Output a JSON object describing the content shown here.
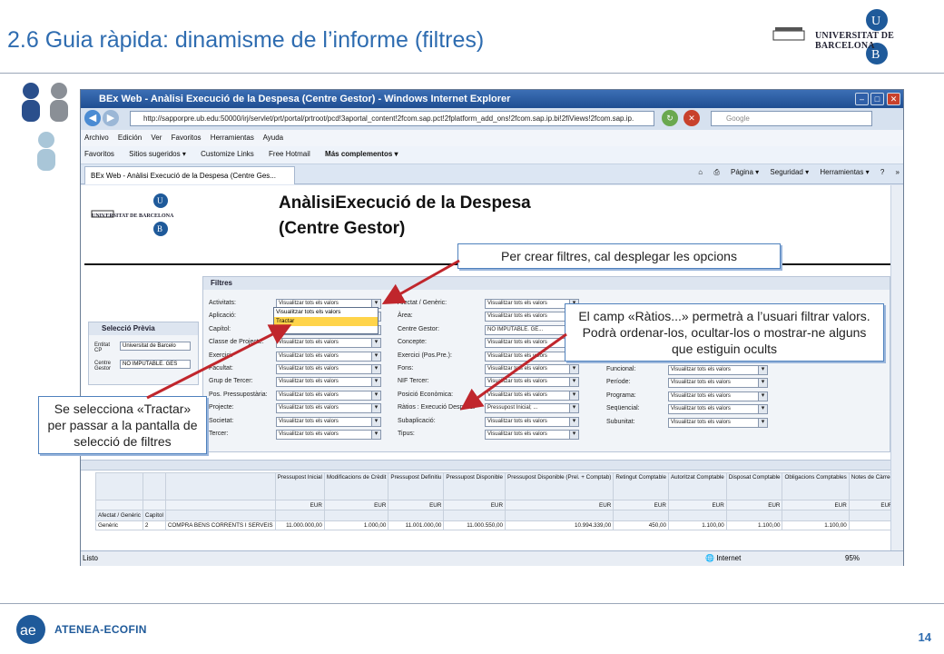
{
  "slide": {
    "title": "2.6 Guia ràpida: dinamisme de l’informe (filtres)",
    "university_name": "UNIVERSITAT DE BARCELONA",
    "page_number": "14",
    "footer_brand": "ATENEA-ECOFIN"
  },
  "browser": {
    "window_title": "BEx Web - Anàlisi Execució de la Despesa (Centre Gestor) - Windows Internet Explorer",
    "address": "http://sapporpre.ub.edu:50000/irj/servlet/prt/portal/prtroot/pcd!3aportal_content!2fcom.sap.pct!2fplatform_add_ons!2fcom.sap.ip.bi!2fiViews!2fcom.sap.ip.",
    "search_placeholder": "Google",
    "menu": [
      "Archivo",
      "Edición",
      "Ver",
      "Favoritos",
      "Herramientas",
      "Ayuda"
    ],
    "favorites": [
      "Favoritos",
      "Sitios sugeridos ▾",
      "Customize Links",
      "Free Hotmail",
      "Más complementos ▾"
    ],
    "tab_title": "BEx Web - Anàlisi Execució de la Despesa (Centre Ges...",
    "commands": [
      "Página ▾",
      "Seguridad ▾",
      "Herramientas ▾",
      "»"
    ],
    "status_left": "Listo",
    "status_zone": "Internet",
    "zoom": "95%"
  },
  "report": {
    "title_line1": "AnàlisiExecució de la Despesa",
    "title_line2": "(Centre Gestor)",
    "filters_heading": "Filtres",
    "prev_heading": "Selecció Prèvia",
    "prev_rows": [
      {
        "label": "Entitat CP",
        "value": "Universitat de Barcelo"
      },
      {
        "label": "Centre Gestor",
        "value": "NO IMPUTABLE. GES"
      }
    ],
    "filters_col1": [
      {
        "label": "Activitats:",
        "value": "Visualitzar tots els valors"
      },
      {
        "label": "Aplicació:",
        "value": "Visualitzar tots els valors"
      },
      {
        "label": "Capítol:",
        "value": "Visualitzar tots els valors"
      },
      {
        "label": "Classe de Projecte:",
        "value": "Visualitzar tots els valors"
      },
      {
        "label": "Exercici:",
        "value": "Visualitzar tots els valors"
      },
      {
        "label": "Facultat:",
        "value": "Visualitzar tots els valors"
      },
      {
        "label": "Grup de Tercer:",
        "value": "Visualitzar tots els valors"
      },
      {
        "label": "Pos. Pressupostària:",
        "value": "Visualitzar tots els valors"
      },
      {
        "label": "Projecte:",
        "value": "Visualitzar tots els valors"
      },
      {
        "label": "Societat:",
        "value": "Visualitzar tots els valors"
      },
      {
        "label": "Tercer:",
        "value": "Visualitzar tots els valors"
      }
    ],
    "filters_col2": [
      {
        "label": "Afectat / Genèric:",
        "value": "Visualitzar tots els valors"
      },
      {
        "label": "Àrea:",
        "value": "Visualitzar tots els valors"
      },
      {
        "label": "Centre Gestor:",
        "value": "NO IMPUTABLE. GE..."
      },
      {
        "label": "Concepte:",
        "value": "Visualitzar tots els valors"
      },
      {
        "label": "Exercici (Pos.Pre.):",
        "value": "Visualitzar tots els valors"
      },
      {
        "label": "Fons:",
        "value": "Visualitzar tots els valors"
      },
      {
        "label": "NIF Tercer:",
        "value": "Visualitzar tots els valors"
      },
      {
        "label": "Posició Econòmica:",
        "value": "Visualitzar tots els valors"
      },
      {
        "label": "Ràtios : Execució Despesa:",
        "value": "Pressupost Inicial; ..."
      },
      {
        "label": "Subaplicació:",
        "value": "Visualitzar tots els valors"
      },
      {
        "label": "Tipus:",
        "value": "Visualitzar tots els valors"
      }
    ],
    "filters_col3": [
      {
        "label": "Funcional:",
        "value": "Visualitzar tots els valors"
      },
      {
        "label": "Període:",
        "value": "Visualitzar tots els valors"
      },
      {
        "label": "Programa:",
        "value": "Visualitzar tots els valors"
      },
      {
        "label": "Seqüencial:",
        "value": "Visualitzar tots els valors"
      },
      {
        "label": "Subunitat:",
        "value": "Visualitzar tots els valors"
      }
    ],
    "dropdown_options": [
      "Visualitzar tots els valors",
      "Tractar"
    ],
    "table": {
      "headers": [
        "Pressupost Inicial",
        "Modificacions de Crèdit",
        "Pressupost Definitiu",
        "Pressupost Disponible",
        "Pressupost Disponible (Prel. + Comptab)",
        "Retingut Comptable",
        "Autoritzat Comptable",
        "Disposat Comptable",
        "Obligacions Comptables",
        "Notes de Càrrec",
        "Obli Note"
      ],
      "dim_headers": [
        "Afectat / Genèric",
        "Capítol"
      ],
      "unit": "EUR",
      "row": {
        "afectat": "Genèric",
        "capitol": "2",
        "description": "COMPRA BENS CORRENTS I SERVEIS",
        "values": [
          "11.000.000,00",
          "1.000,00",
          "11.001.000,00",
          "11.000.550,00",
          "10.994.339,00",
          "450,00",
          "1.100,00",
          "1.100,00",
          "1.100,00",
          "",
          ""
        ]
      }
    }
  },
  "callouts": {
    "top": "Per crear filtres, cal desplegar les opcions",
    "right": "El camp «Ràtios...» permetrà a l’usuari filtrar valors. Podrà ordenar-los, ocultar-los o mostrar-ne alguns que estiguin ocults",
    "left": "Se selecciona «Tractar» per passar a la pantalla de selecció de filtres"
  },
  "colors": {
    "title": "#2e6cb0",
    "arrow": "#c0262c",
    "callout_border": "#4f81bd"
  }
}
